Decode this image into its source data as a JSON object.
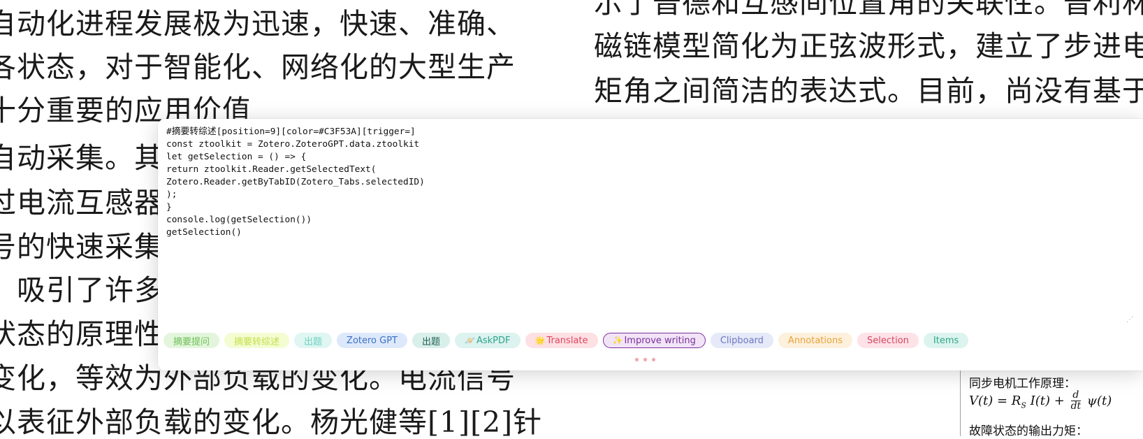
{
  "document": {
    "left_lines": [
      "自动化进程发展极为迅速，快速、准确、",
      "各状态，对于智能化、网络化的大型生产",
      "十分重要的应用价值",
      "自动采集。其",
      "过电流互感器",
      "号的快速采集",
      "。吸引了许多",
      "状态的原理性",
      "变化，等效为外部负载的变化。电流信号",
      "以表征外部负载的变化。杨光健等[1][2]针"
    ],
    "right_lines": [
      "示了普德和互感间位置角的关联性。普利林",
      "磁链模型简化为正弦波形式，建立了步进电",
      "矩角之间简洁的表达式。目前，尚没有基于"
    ],
    "side_card": {
      "heading": "同步电机工作原理：",
      "formula_left": "V(t) = R",
      "formula_sub": "S",
      "formula_mid": "I(t) +",
      "frac_num": "d",
      "frac_den": "dt",
      "formula_right": "ψ(t)",
      "heading2": "故障状态的输出力矩："
    }
  },
  "prompt_editor": {
    "code": "#摘要转综述[position=9][color=#C3F53A][trigger=]\nconst ztoolkit = Zotero.ZoteroGPT.data.ztoolkit\nlet getSelection = () => {\nreturn ztoolkit.Reader.getSelectedText(\nZotero.Reader.getByTabID(Zotero_Tabs.selectedID)\n);\n}\nconsole.log(getSelection())\ngetSelection()",
    "resize_glyph": "⋰"
  },
  "tags": [
    {
      "label": "摘要提问",
      "icon": "",
      "bg": "#e3f5dc",
      "fg": "#6cbf54",
      "border": "#e3f5dc"
    },
    {
      "label": "摘要转综述",
      "icon": "",
      "bg": "#f4fcd2",
      "fg": "#c3e04a",
      "border": "#f4fcd2"
    },
    {
      "label": "出题",
      "icon": "",
      "bg": "#dff6f2",
      "fg": "#6fd0c0",
      "border": "#dff6f2"
    },
    {
      "label": "Zotero GPT",
      "icon": "",
      "bg": "#dde9fb",
      "fg": "#3b6fc7",
      "border": "#dde9fb"
    },
    {
      "label": "出题",
      "icon": "",
      "bg": "#d9efe9",
      "fg": "#1f5f55",
      "border": "#d9efe9"
    },
    {
      "label": "AskPDF",
      "icon": "🪐",
      "bg": "#dcf3ef",
      "fg": "#2fa38c",
      "border": "#dcf3ef"
    },
    {
      "label": "Translate",
      "icon": "🌟",
      "bg": "#fde0e4",
      "fg": "#e0445e",
      "border": "#fde0e4"
    },
    {
      "label": "Improve writing",
      "icon": "✨",
      "bg": "#f1e4f7",
      "fg": "#7a2f9a",
      "border": "#7a2f9a"
    },
    {
      "label": "Clipboard",
      "icon": "",
      "bg": "#e6e9f7",
      "fg": "#6b78c4",
      "border": "#e6e9f7"
    },
    {
      "label": "Annotations",
      "icon": "",
      "bg": "#fdf0dc",
      "fg": "#e8a33a",
      "border": "#fdf0dc"
    },
    {
      "label": "Selection",
      "icon": "",
      "bg": "#fde2e8",
      "fg": "#d6475f",
      "border": "#fde2e8"
    },
    {
      "label": "Items",
      "icon": "",
      "bg": "#dcf3ee",
      "fg": "#2ea58b",
      "border": "#dcf3ee"
    }
  ],
  "colors": {
    "dots": "#f3a4ab"
  }
}
